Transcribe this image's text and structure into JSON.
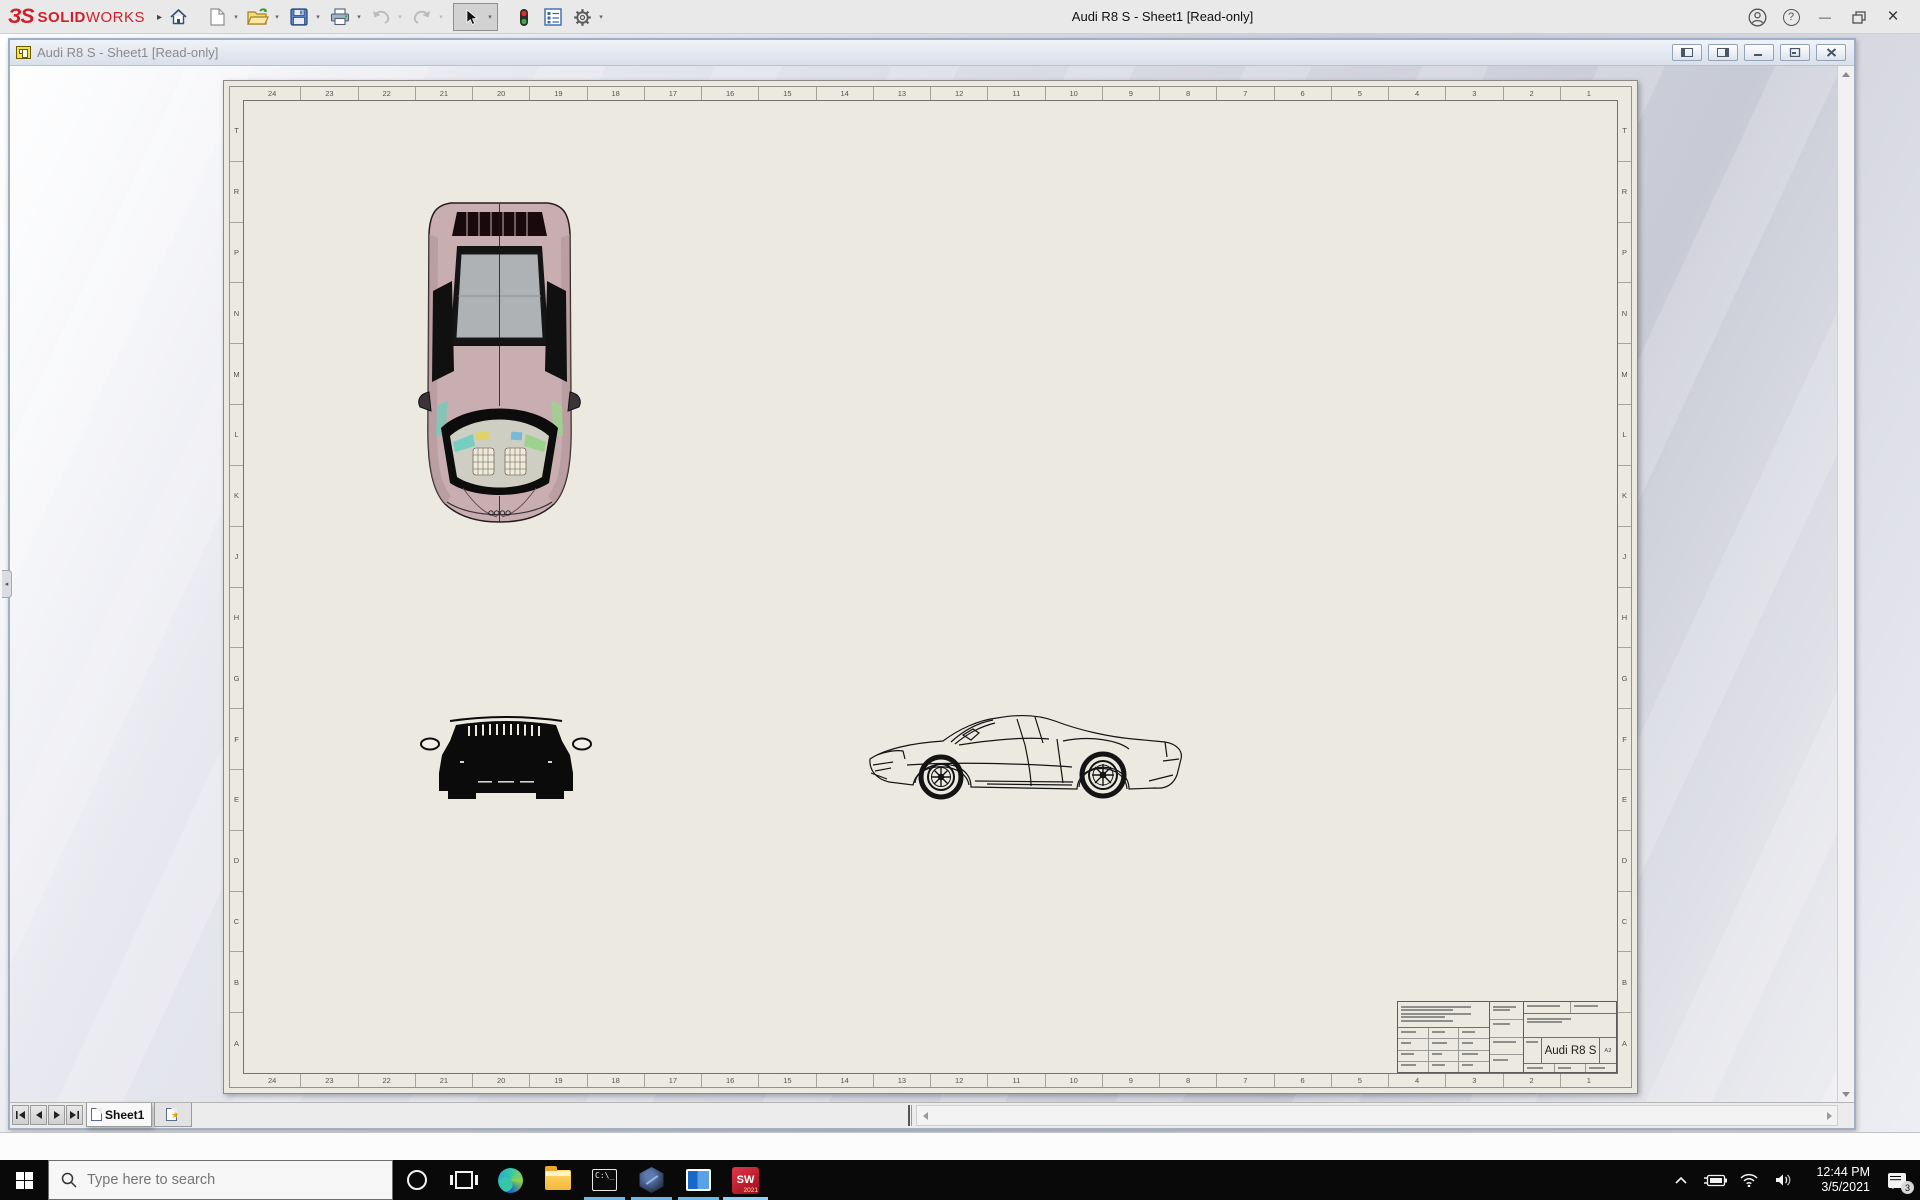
{
  "window": {
    "title": "Audi R8 S - Sheet1 [Read-only]",
    "brand": {
      "mark": "ЗS",
      "name_bold": "SOLID",
      "name_light": "WORKS",
      "flyout": "▸",
      "red": "#d21e2b"
    },
    "toolbar_icons": [
      "home",
      "new-document",
      "open",
      "save",
      "print",
      "undo",
      "redo",
      "select",
      "performance",
      "property-list",
      "settings"
    ],
    "controls": [
      "account",
      "help",
      "minimize",
      "restore",
      "close"
    ],
    "help_glyph": "?",
    "minimize_glyph": "—",
    "close_glyph": "×"
  },
  "doc_window": {
    "title": "Audi R8 S - Sheet1 [Read-only]",
    "buttons": [
      "pane-left",
      "pane-right",
      "minimize",
      "maximize",
      "close"
    ]
  },
  "sheet": {
    "zone_columns": [
      "24",
      "23",
      "22",
      "21",
      "20",
      "19",
      "18",
      "17",
      "16",
      "15",
      "14",
      "13",
      "12",
      "11",
      "10",
      "9",
      "8",
      "7",
      "6",
      "5",
      "4",
      "3",
      "2",
      "1"
    ],
    "zone_rows": [
      "T",
      "R",
      "P",
      "N",
      "M",
      "L",
      "K",
      "J",
      "H",
      "G",
      "F",
      "E",
      "D",
      "C",
      "B",
      "A"
    ],
    "paper_color": "#ebe9e0",
    "views": [
      "top-view-shaded",
      "front-view-silhouette",
      "side-view-wireframe"
    ],
    "title_block": {
      "title": "Audi R8 S",
      "size": "A2"
    }
  },
  "tabs": {
    "sheet1_label": "Sheet1"
  },
  "taskbar": {
    "search_placeholder": "Type here to search",
    "icons": [
      "start",
      "cortana",
      "task-view",
      "edge",
      "file-explorer",
      "terminal",
      "3dexperience",
      "app-window",
      "solidworks-2021"
    ],
    "running_underline_color": "#6cb8e8",
    "sw_badge_year": "2021",
    "time": "12:44 PM",
    "date": "3/5/2021",
    "notification_count": "3"
  }
}
